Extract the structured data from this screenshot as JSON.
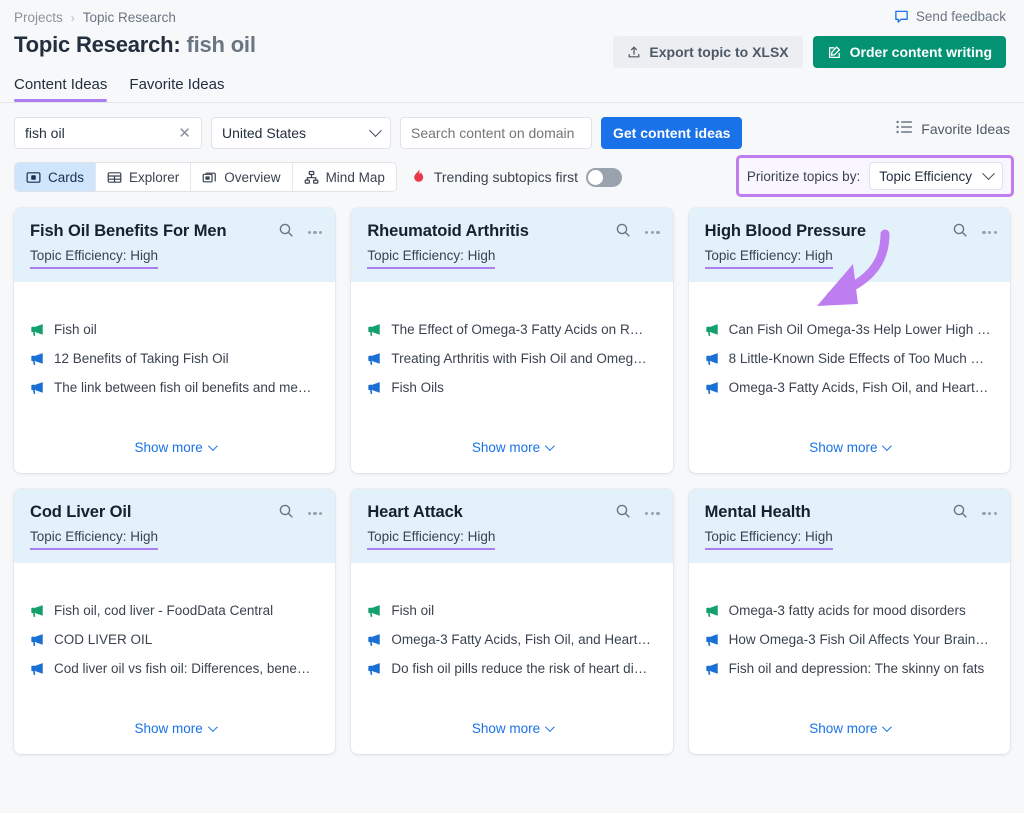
{
  "breadcrumb": {
    "root": "Projects",
    "separator": "›",
    "current": "Topic Research"
  },
  "feedback": {
    "label": "Send feedback",
    "icon": "speech-bubble-icon"
  },
  "header": {
    "title_prefix": "Topic Research:",
    "title_keyword": "fish oil",
    "export_label": "Export topic to XLSX",
    "export_icon": "upload-icon",
    "order_label": "Order content writing",
    "order_icon": "pencil-square-icon",
    "green": "#049372"
  },
  "tabs": [
    {
      "label": "Content Ideas",
      "active": true
    },
    {
      "label": "Favorite Ideas",
      "active": false
    }
  ],
  "filters": {
    "keyword_value": "fish oil",
    "keyword_clear_icon": "close-icon",
    "country_value": "United States",
    "domain_placeholder": "Search content on domain",
    "domain_value": "",
    "submit_label": "Get content ideas",
    "favorite_ideas_label": "Favorite Ideas",
    "favorite_ideas_icon": "list-icon"
  },
  "views": [
    {
      "label": "Cards",
      "icon": "cards-icon",
      "active": true
    },
    {
      "label": "Explorer",
      "icon": "table-icon",
      "active": false
    },
    {
      "label": "Overview",
      "icon": "overview-icon",
      "active": false
    },
    {
      "label": "Mind Map",
      "icon": "mindmap-icon",
      "active": false
    }
  ],
  "trending": {
    "label": "Trending subtopics first",
    "icon": "flame-icon",
    "enabled": false
  },
  "prioritize": {
    "label": "Prioritize topics by:",
    "value": "Topic Efficiency",
    "highlight_color": "#bf7ef0"
  },
  "card_common": {
    "efficiency_label": "Topic Efficiency:",
    "show_more_label": "Show more",
    "search_icon": "magnifier-icon",
    "menu_icon": "ellipsis-icon",
    "idea_icon": "megaphone-icon"
  },
  "cards": [
    {
      "title": "Fish Oil Benefits For Men",
      "efficiency": "High",
      "ideas": [
        {
          "text": "Fish oil",
          "color": "green"
        },
        {
          "text": "12 Benefits of Taking Fish Oil",
          "color": "blue"
        },
        {
          "text": "The link between fish oil benefits and me…",
          "color": "blue"
        }
      ]
    },
    {
      "title": "Rheumatoid Arthritis",
      "efficiency": "High",
      "ideas": [
        {
          "text": "The Effect of Omega-3 Fatty Acids on R…",
          "color": "green"
        },
        {
          "text": "Treating Arthritis with Fish Oil and Omeg…",
          "color": "blue"
        },
        {
          "text": "Fish Oils",
          "color": "blue"
        }
      ]
    },
    {
      "title": "High Blood Pressure",
      "efficiency": "High",
      "ideas": [
        {
          "text": "Can Fish Oil Omega-3s Help Lower High …",
          "color": "green"
        },
        {
          "text": "8 Little-Known Side Effects of Too Much …",
          "color": "blue"
        },
        {
          "text": "Omega-3 Fatty Acids, Fish Oil, and Heart…",
          "color": "blue"
        }
      ]
    },
    {
      "title": "Cod Liver Oil",
      "efficiency": "High",
      "ideas": [
        {
          "text": "Fish oil, cod liver - FoodData Central",
          "color": "green"
        },
        {
          "text": "COD LIVER OIL",
          "color": "blue"
        },
        {
          "text": "Cod liver oil vs fish oil: Differences, bene…",
          "color": "blue"
        }
      ]
    },
    {
      "title": "Heart Attack",
      "efficiency": "High",
      "ideas": [
        {
          "text": "Fish oil",
          "color": "green"
        },
        {
          "text": "Omega-3 Fatty Acids, Fish Oil, and Heart…",
          "color": "blue"
        },
        {
          "text": "Do fish oil pills reduce the risk of heart di…",
          "color": "blue"
        }
      ]
    },
    {
      "title": "Mental Health",
      "efficiency": "High",
      "ideas": [
        {
          "text": "Omega-3 fatty acids for mood disorders",
          "color": "green"
        },
        {
          "text": "How Omega-3 Fish Oil Affects Your Brain…",
          "color": "blue"
        },
        {
          "text": "Fish oil and depression: The skinny on fats",
          "color": "blue"
        }
      ]
    }
  ],
  "annotation": {
    "type": "curved-arrow",
    "color": "#bf7ef0"
  }
}
